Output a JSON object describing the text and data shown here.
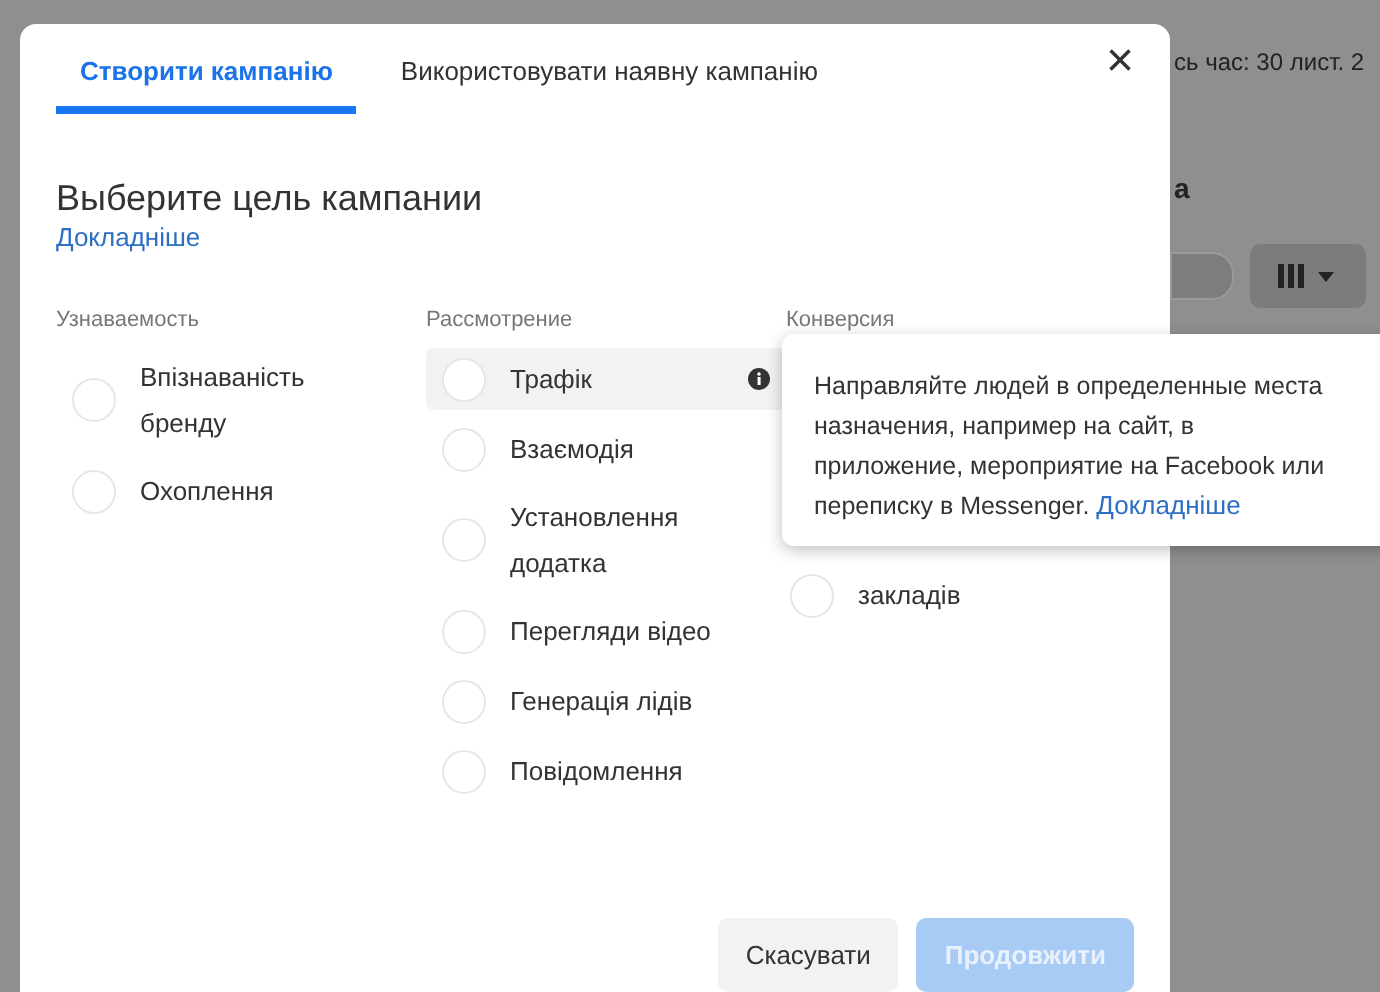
{
  "background": {
    "header_text": "сь час: 30 лист. 2",
    "section_text": "а",
    "toggle_on": false
  },
  "dialog": {
    "tabs": [
      {
        "label": "Створити кампанію",
        "selected": true
      },
      {
        "label": "Використовувати наявну кампанію",
        "selected": false
      }
    ],
    "close": "×",
    "title": "Выберите цель кампании",
    "learn_more": "Докладніше",
    "columns": [
      {
        "heading": "Узнаваемость",
        "options": [
          {
            "label": "Впізнаваність бренду",
            "checked": false,
            "highlighted": false,
            "info": false
          },
          {
            "label": "Охоплення",
            "checked": false,
            "highlighted": false,
            "info": false
          }
        ]
      },
      {
        "heading": "Рассмотрение",
        "options": [
          {
            "label": "Трафік",
            "checked": false,
            "highlighted": true,
            "info": true
          },
          {
            "label": "Взаємодія",
            "checked": false,
            "highlighted": false,
            "info": false
          },
          {
            "label": "Установлення додатка",
            "checked": false,
            "highlighted": false,
            "info": false
          },
          {
            "label": "Перегляди відео",
            "checked": false,
            "highlighted": false,
            "info": false
          },
          {
            "label": "Генерація лідів",
            "checked": false,
            "highlighted": false,
            "info": false
          },
          {
            "label": "Повідомлення",
            "checked": false,
            "highlighted": false,
            "info": false
          }
        ]
      },
      {
        "heading": "Конверсия",
        "options": [
          {
            "label": "закладів",
            "checked": false,
            "highlighted": false,
            "info": false
          }
        ]
      }
    ],
    "tooltip": {
      "text": "Направляйте людей в определенные места назначения, например на сайт, в приложение, мероприятие на Facebook или переписку в Messenger.",
      "link": "Докладніше"
    },
    "buttons": [
      {
        "label": "Скасувати",
        "kind": "secondary",
        "disabled": false
      },
      {
        "label": "Продовжити",
        "kind": "primary",
        "disabled": true
      }
    ]
  }
}
